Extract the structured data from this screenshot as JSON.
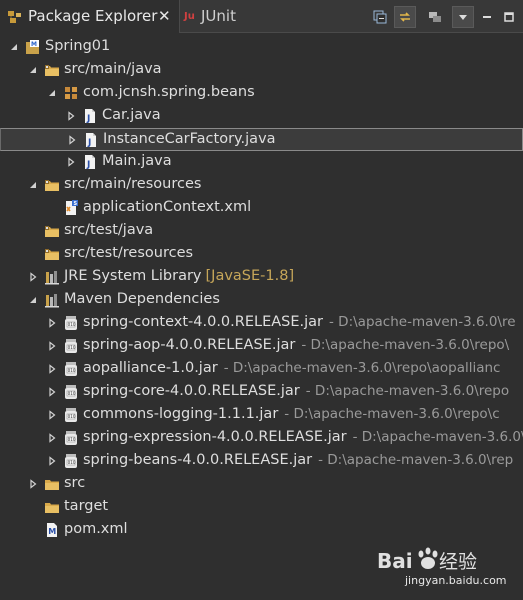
{
  "tabs": [
    {
      "label": "Package Explorer",
      "active": true,
      "icon": "package-explorer-icon"
    },
    {
      "label": "JUnit",
      "active": false,
      "icon": "junit-icon"
    }
  ],
  "toolbar": {
    "buttons": [
      {
        "name": "collapse-all-button",
        "icon": "collapse-all-icon"
      },
      {
        "name": "link-with-editor-button",
        "icon": "link-with-editor-icon",
        "active": true
      },
      {
        "name": "focus-on-working-set-button",
        "icon": "working-set-icon"
      },
      {
        "name": "view-menu-button",
        "icon": "view-menu-icon"
      },
      {
        "name": "minimize-button",
        "icon": "minimize-icon"
      },
      {
        "name": "maximize-button",
        "icon": "maximize-icon"
      }
    ]
  },
  "tree": [
    {
      "label": "Spring01",
      "icon": "project-icon",
      "expanded": true,
      "arrow": "down"
    },
    {
      "label": "src/main/java",
      "icon": "source-folder-icon",
      "expanded": true,
      "arrow": "down"
    },
    {
      "label": "com.jcnsh.spring.beans",
      "icon": "package-icon",
      "expanded": true,
      "arrow": "down"
    },
    {
      "label": "Car.java",
      "icon": "java-file-icon",
      "arrow": "right"
    },
    {
      "label": "InstanceCarFactory.java",
      "icon": "java-file-icon",
      "arrow": "right",
      "selected": true
    },
    {
      "label": "Main.java",
      "icon": "java-file-icon",
      "arrow": "right"
    },
    {
      "label": "src/main/resources",
      "icon": "source-folder-icon",
      "expanded": true,
      "arrow": "down"
    },
    {
      "label": "applicationContext.xml",
      "icon": "xml-file-icon"
    },
    {
      "label": "src/test/java",
      "icon": "source-folder-icon"
    },
    {
      "label": "src/test/resources",
      "icon": "source-folder-icon"
    },
    {
      "label": "JRE System Library",
      "decoration": "[JavaSE-1.8]",
      "icon": "library-icon",
      "arrow": "right"
    },
    {
      "label": "Maven Dependencies",
      "icon": "library-icon",
      "expanded": true,
      "arrow": "down"
    },
    {
      "label": "spring-context-4.0.0.RELEASE.jar",
      "decoration": "- D:\\apache-maven-3.6.0\\re",
      "icon": "jar-icon",
      "arrow": "right"
    },
    {
      "label": "spring-aop-4.0.0.RELEASE.jar",
      "decoration": "- D:\\apache-maven-3.6.0\\repo\\",
      "icon": "jar-icon",
      "arrow": "right"
    },
    {
      "label": "aopalliance-1.0.jar",
      "decoration": "- D:\\apache-maven-3.6.0\\repo\\aopallianc",
      "icon": "jar-icon",
      "arrow": "right"
    },
    {
      "label": "spring-core-4.0.0.RELEASE.jar",
      "decoration": "- D:\\apache-maven-3.6.0\\repo",
      "icon": "jar-icon",
      "arrow": "right"
    },
    {
      "label": "commons-logging-1.1.1.jar",
      "decoration": "- D:\\apache-maven-3.6.0\\repo\\c",
      "icon": "jar-icon",
      "arrow": "right"
    },
    {
      "label": "spring-expression-4.0.0.RELEASE.jar",
      "decoration": "- D:\\apache-maven-3.6.0\\",
      "icon": "jar-icon",
      "arrow": "right"
    },
    {
      "label": "spring-beans-4.0.0.RELEASE.jar",
      "decoration": "- D:\\apache-maven-3.6.0\\rep",
      "icon": "jar-icon",
      "arrow": "right"
    },
    {
      "label": "src",
      "icon": "folder-icon",
      "arrow": "right"
    },
    {
      "label": "target",
      "icon": "folder-icon"
    },
    {
      "label": "pom.xml",
      "icon": "maven-pom-icon"
    }
  ],
  "watermark": {
    "brand": "Baidu",
    "brand_cn": "经验",
    "url": "jingyan.baidu.com"
  },
  "colors": {
    "background": "#2f2f2f",
    "text": "#dedede",
    "decoration": "#9a9a9a",
    "jre_decoration": "#c6a659",
    "selection_border": "#8a8a8a"
  }
}
